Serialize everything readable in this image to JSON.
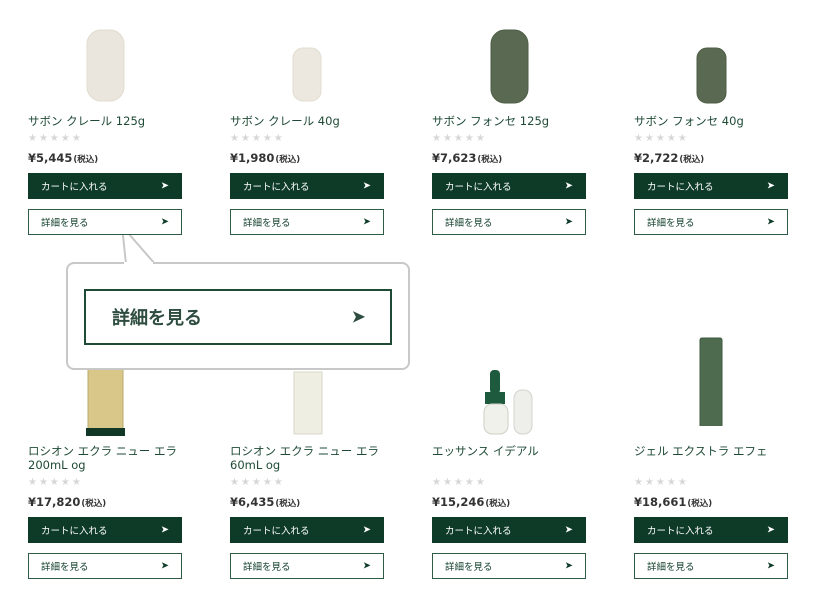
{
  "products": [
    {
      "name": "サボン クレール 125g",
      "price": "¥5,445",
      "tax": "(税込)",
      "cart_label": "カートに入れる",
      "detail_label": "詳細を見る"
    },
    {
      "name": "サボン クレール 40g",
      "price": "¥1,980",
      "tax": "(税込)",
      "cart_label": "カートに入れる",
      "detail_label": "詳細を見る"
    },
    {
      "name": "サボン フォンセ 125g",
      "price": "¥7,623",
      "tax": "(税込)",
      "cart_label": "カートに入れる",
      "detail_label": "詳細を見る"
    },
    {
      "name": "サボン フォンセ 40g",
      "price": "¥2,722",
      "tax": "(税込)",
      "cart_label": "カートに入れる",
      "detail_label": "詳細を見る"
    },
    {
      "name": "ロシオン エクラ ニュー エラ\n200mL og",
      "price": "¥17,820",
      "tax": "(税込)",
      "cart_label": "カートに入れる",
      "detail_label": "詳細を見る"
    },
    {
      "name": "ロシオン エクラ ニュー エラ\n60mL og",
      "price": "¥6,435",
      "tax": "(税込)",
      "cart_label": "カートに入れる",
      "detail_label": "詳細を見る"
    },
    {
      "name": "エッサンス イデアル",
      "price": "¥15,246",
      "tax": "(税込)",
      "cart_label": "カートに入れる",
      "detail_label": "詳細を見る"
    },
    {
      "name": "ジェル エクストラ エフェ",
      "price": "¥18,661",
      "tax": "(税込)",
      "cart_label": "カートに入れる",
      "detail_label": "詳細を見る"
    }
  ],
  "rating_stars": "★★★★★",
  "arrow_glyph": "➤",
  "callout": {
    "label": "詳細を見る"
  },
  "colors": {
    "primary": "#0e3b28",
    "stars": "#d7d7d7",
    "text": "#1f4a36"
  }
}
